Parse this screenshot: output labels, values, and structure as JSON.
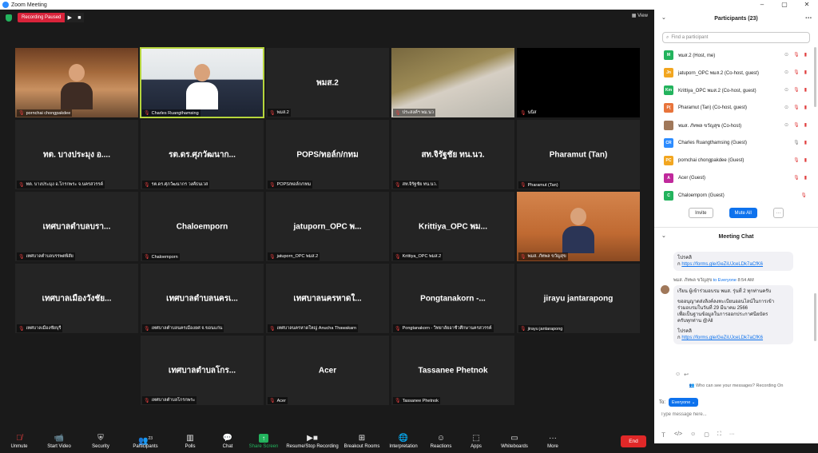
{
  "window": {
    "title": "Zoom Meeting",
    "buttons": [
      "–",
      "▢",
      "✕"
    ]
  },
  "recording": {
    "status": "Recording Paused",
    "play": "▶",
    "stop": "■"
  },
  "view_label": "View",
  "tiles": [
    {
      "name": "pornchai chongpakdee",
      "center": "",
      "video": "vid1"
    },
    {
      "name": "Charles Ruangthamsing",
      "center": "",
      "video": "vid2"
    },
    {
      "name": "พมส.2",
      "center": "พมส.2",
      "video": ""
    },
    {
      "name": "ประสงค์ฯ พม.นว",
      "center": "",
      "video": "vid4"
    },
    {
      "name": "นนิส",
      "center": "",
      "video": "vid5"
    },
    {
      "name": "ทต. บางประมุง อ.โกรกพระ จ.นครสวรรค์",
      "center": "ทต. บางประมุง อ....",
      "video": ""
    },
    {
      "name": "รต.ดร.ศุภวัฒนากร วงศ์ธนเวส",
      "center": "รต.ดร.ศุภวัฒนาก...",
      "video": ""
    },
    {
      "name": "POPS/ทอล์ก/กทม",
      "center": "POPS/ทอล์ก/กทม",
      "video": ""
    },
    {
      "name": "สท.จิรัฐชัย ทน.นว.",
      "center": "สท.จิรัฐชัย ทน.นว.",
      "video": ""
    },
    {
      "name": "Pharamut (Tan)",
      "center": "Pharamut (Tan)",
      "video": ""
    },
    {
      "name": "เทศบาลตำบลบรรพตพิสัย",
      "center": "เทศบาลตำบลบรา...",
      "video": ""
    },
    {
      "name": "Chaloemporn",
      "center": "Chaloemporn",
      "video": ""
    },
    {
      "name": "jatuporn_OPC พมส.2",
      "center": "jatuporn_OPC พ...",
      "video": ""
    },
    {
      "name": "Krittiya_OPC พมส.2",
      "center": "Krittiya_OPC พม...",
      "video": ""
    },
    {
      "name": "พมส. ภัทพล ขวัญสุข",
      "center": "",
      "video": "vid-man"
    },
    {
      "name": "เทศบาลเมืองชัยบุรี",
      "center": "เทศบาลเมืองวังชัย...",
      "video": ""
    },
    {
      "name": "เทศบาลตำบลนครเมืองยศ จ.ขอนแก่น",
      "center": "เทศบาลตำบลนครเ...",
      "video": ""
    },
    {
      "name": "เทศบาลนครหาดใหญ่ Anucha Thawakarn",
      "center": "เทศบาลนครหาดใ...",
      "video": ""
    },
    {
      "name": "Pongtanakorn - วิทยาลัยอาชีวศึกษานครสวรรค์",
      "center": "Pongtanakorn -...",
      "video": ""
    },
    {
      "name": "jirayu jantarapong",
      "center": "jirayu jantarapong",
      "video": ""
    },
    {
      "name": "",
      "center": "",
      "video": "empty"
    },
    {
      "name": "เทศบาลตำบลโกรกพระ",
      "center": "เทศบาลตำบลโกร...",
      "video": ""
    },
    {
      "name": "Acer",
      "center": "Acer",
      "video": ""
    },
    {
      "name": "Tassanee Phetnok",
      "center": "Tassanee Phetnok",
      "video": ""
    }
  ],
  "toolbar": {
    "unmute": "Unmute",
    "start_video": "Start Video",
    "security": "Security",
    "participants": "Participants",
    "participant_count": "23",
    "polls": "Polls",
    "chat": "Chat",
    "share_screen": "Share Screen",
    "recording": "Resume/Stop Recording",
    "breakout": "Breakout Rooms",
    "interpretation": "Interpretation",
    "reactions": "Reactions",
    "apps": "Apps",
    "whiteboards": "Whiteboards",
    "more": "More",
    "end": "End"
  },
  "participants_panel": {
    "title": "Participants (23)",
    "search_placeholder": "Find a participant",
    "items": [
      {
        "initials": "M",
        "color": "#23b35d",
        "name": "พมส.2 (Host, me)"
      },
      {
        "initials": "Jn",
        "color": "#f2a620",
        "name": "jatuporn_OPC พมส.2 (Co-host, guest)"
      },
      {
        "initials": "Km",
        "color": "#23b35d",
        "name": "Krittiya_OPC พมส.2 (Co-host, guest)"
      },
      {
        "initials": "P(",
        "color": "#e8743b",
        "name": "Pharamut (Tan) (Co-host, guest)"
      },
      {
        "initials": "",
        "color": "#a0785a",
        "name": "พมส. ภัทพล ขวัญสุข (Co-host)"
      },
      {
        "initials": "CR",
        "color": "#2d8cff",
        "name": "Charles Ruangthamsing (Guest)"
      },
      {
        "initials": "PC",
        "color": "#f2a620",
        "name": "pornchai chongpakdee (Guest)"
      },
      {
        "initials": "A",
        "color": "#c0299c",
        "name": "Acer (Guest)"
      },
      {
        "initials": "C",
        "color": "#23b35d",
        "name": "Chaloemporn (Guest)"
      }
    ],
    "invite": "Invite",
    "mute_all": "Mute All",
    "more": "···"
  },
  "chat_panel": {
    "title": "Meeting Chat",
    "msg1_line1": "โปรคลิ",
    "msg1_line2_prefix": "ก ",
    "msg1_link": "https://forms.gle/GeZiUJceLDk7aCfK6",
    "sender": "พมส. ภัทพล ขวัญสุข",
    "to": "to Everyone",
    "time": "8:54 AM",
    "msg2_line1": "เรียน ผู้เข้าร่วมอบรม พมส. รุ่นที่ 2 ทุกท่านครับ",
    "msg2_line2": "ขออนุญาตส่งลิงค์ลงทะเบียนออนไลน์ในการเข้า",
    "msg2_line3": "ร่วมอบรมในวันที่ 29 มีนาคม 2566",
    "msg2_line4": "เพื่อเป็นฐานข้อมูลในการออกประกาศนียบัตร",
    "msg2_line5": "ครับทุกท่าน @All",
    "msg2_line6": "โปรคลิ",
    "msg2_line7_prefix": "ก ",
    "msg2_link": "https://forms.gle/GeZiUJceLDk7aCfK6",
    "who_can_see": "Who can see your messages? Recording On",
    "to_label": "To:",
    "to_value": "Everyone",
    "input_placeholder": "Type message here..."
  }
}
